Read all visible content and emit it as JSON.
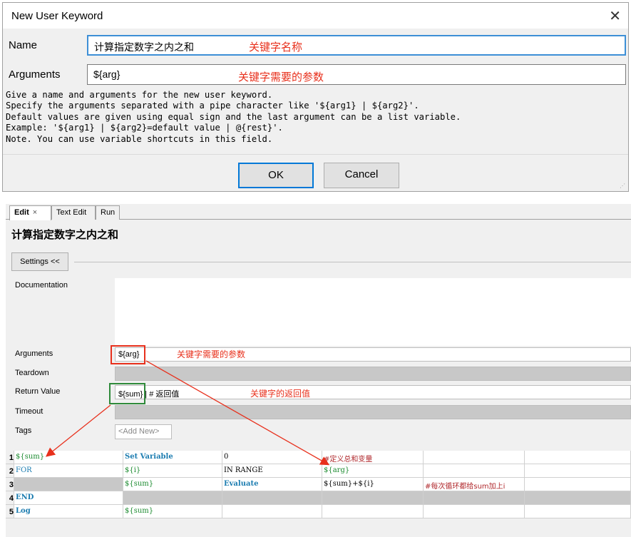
{
  "dialog": {
    "title": "New User Keyword",
    "close_glyph": "✕",
    "name_label": "Name",
    "name_value": "计算指定数字之内之和",
    "name_annotation": "关键字名称",
    "args_label": "Arguments",
    "args_value": "${arg}",
    "args_annotation": "关键字需要的参数",
    "help_text": "Give a name and arguments for the new user keyword.\nSpecify the arguments separated with a pipe character like '${arg1} | ${arg2}'.\nDefault values are given using equal sign and the last argument can be a list variable.\nExample: '${arg1} | ${arg2}=default value | @{rest}'.\nNote. You can use variable shortcuts in this field.",
    "ok_label": "OK",
    "cancel_label": "Cancel"
  },
  "editor": {
    "tabs": [
      {
        "label": "Edit",
        "close": "×"
      },
      {
        "label": "Text Edit"
      },
      {
        "label": "Run"
      }
    ],
    "keyword_title": "计算指定数字之内之和",
    "settings_button": "Settings <<",
    "settings": {
      "documentation_label": "Documentation",
      "arguments_label": "Arguments",
      "arguments_value": "${arg}",
      "arguments_annotation": "关键字需要的参数",
      "teardown_label": "Teardown",
      "return_label": "Return Value",
      "return_value": "${sum} | # 返回值",
      "return_annotation": "关键字的返回值",
      "timeout_label": "Timeout",
      "tags_label": "Tags",
      "tags_add_new": "<Add New>"
    },
    "grid": {
      "rows": [
        {
          "num": "1",
          "cells": [
            "${sum}",
            "Set Variable",
            "0",
            "#定义总和变量",
            "",
            ""
          ]
        },
        {
          "num": "2",
          "cells": [
            "FOR",
            "${i}",
            "IN RANGE",
            "${arg}",
            "",
            ""
          ]
        },
        {
          "num": "3",
          "cells": [
            "",
            "${sum}",
            "Evaluate",
            "${sum}+${i}",
            "#每次循环都给sum加上i",
            ""
          ]
        },
        {
          "num": "4",
          "cells": [
            "END",
            "",
            "",
            "",
            "",
            ""
          ]
        },
        {
          "num": "5",
          "cells": [
            "Log",
            "${sum}",
            "",
            "",
            "",
            ""
          ]
        }
      ]
    }
  },
  "colors": {
    "annotation_red": "#e8301c",
    "highlight_green": "#2f8a3a",
    "keyword_blue": "#1b7cb0",
    "variable_green": "#1a8a2e",
    "comment_red": "#b0282c"
  }
}
